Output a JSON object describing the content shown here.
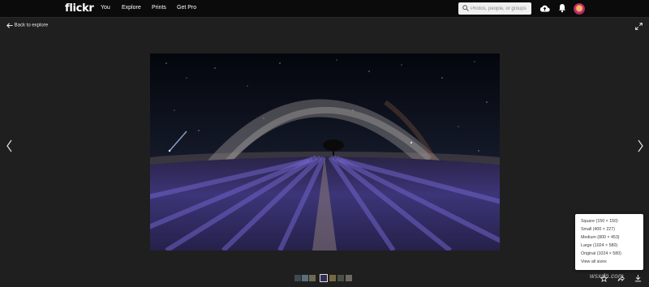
{
  "header": {
    "logo": "flickr",
    "nav": [
      "You",
      "Explore",
      "Prints",
      "Get Pro"
    ],
    "search_placeholder": "Photos, people, or groups"
  },
  "photo_page": {
    "back_label": "Back to explore",
    "download_menu": {
      "items": [
        "Square (150 × 150)",
        "Small (400 × 227)",
        "Medium (800 × 453)",
        "Large (1024 × 580)",
        "Original (1024 × 580)",
        "View all sizes"
      ]
    }
  },
  "watermark": "wsxdn.com",
  "icons": {
    "search": "search-icon",
    "upload": "cloud-upload-icon",
    "notifications": "bell-icon",
    "back": "arrow-left-icon",
    "expand": "expand-icon",
    "prev": "chevron-left-icon",
    "next": "chevron-right-icon",
    "favorite": "star-icon",
    "share": "share-icon",
    "download": "download-icon"
  },
  "colors": {
    "topbar": "#0b0b0b",
    "background": "#1f1f20",
    "accent_avatar": "#c9325b"
  }
}
